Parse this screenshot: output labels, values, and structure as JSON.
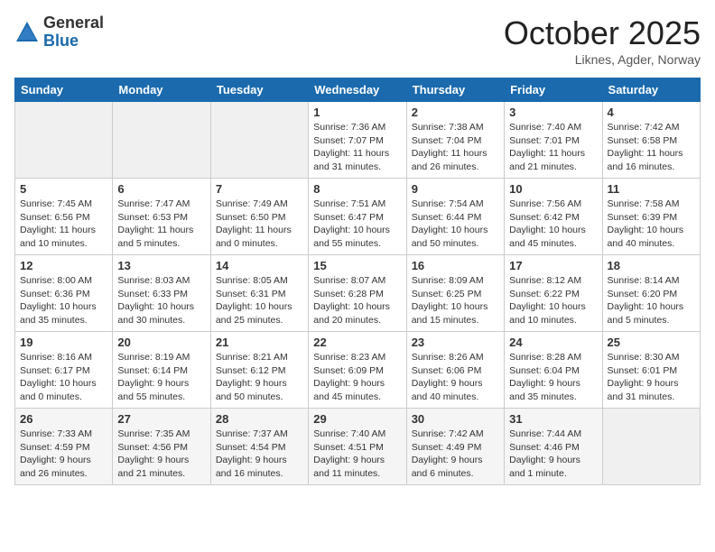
{
  "header": {
    "logo_general": "General",
    "logo_blue": "Blue",
    "month_title": "October 2025",
    "location": "Liknes, Agder, Norway"
  },
  "days_of_week": [
    "Sunday",
    "Monday",
    "Tuesday",
    "Wednesday",
    "Thursday",
    "Friday",
    "Saturday"
  ],
  "weeks": [
    [
      {
        "day": "",
        "info": ""
      },
      {
        "day": "",
        "info": ""
      },
      {
        "day": "",
        "info": ""
      },
      {
        "day": "1",
        "info": "Sunrise: 7:36 AM\nSunset: 7:07 PM\nDaylight: 11 hours\nand 31 minutes."
      },
      {
        "day": "2",
        "info": "Sunrise: 7:38 AM\nSunset: 7:04 PM\nDaylight: 11 hours\nand 26 minutes."
      },
      {
        "day": "3",
        "info": "Sunrise: 7:40 AM\nSunset: 7:01 PM\nDaylight: 11 hours\nand 21 minutes."
      },
      {
        "day": "4",
        "info": "Sunrise: 7:42 AM\nSunset: 6:58 PM\nDaylight: 11 hours\nand 16 minutes."
      }
    ],
    [
      {
        "day": "5",
        "info": "Sunrise: 7:45 AM\nSunset: 6:56 PM\nDaylight: 11 hours\nand 10 minutes."
      },
      {
        "day": "6",
        "info": "Sunrise: 7:47 AM\nSunset: 6:53 PM\nDaylight: 11 hours\nand 5 minutes."
      },
      {
        "day": "7",
        "info": "Sunrise: 7:49 AM\nSunset: 6:50 PM\nDaylight: 11 hours\nand 0 minutes."
      },
      {
        "day": "8",
        "info": "Sunrise: 7:51 AM\nSunset: 6:47 PM\nDaylight: 10 hours\nand 55 minutes."
      },
      {
        "day": "9",
        "info": "Sunrise: 7:54 AM\nSunset: 6:44 PM\nDaylight: 10 hours\nand 50 minutes."
      },
      {
        "day": "10",
        "info": "Sunrise: 7:56 AM\nSunset: 6:42 PM\nDaylight: 10 hours\nand 45 minutes."
      },
      {
        "day": "11",
        "info": "Sunrise: 7:58 AM\nSunset: 6:39 PM\nDaylight: 10 hours\nand 40 minutes."
      }
    ],
    [
      {
        "day": "12",
        "info": "Sunrise: 8:00 AM\nSunset: 6:36 PM\nDaylight: 10 hours\nand 35 minutes."
      },
      {
        "day": "13",
        "info": "Sunrise: 8:03 AM\nSunset: 6:33 PM\nDaylight: 10 hours\nand 30 minutes."
      },
      {
        "day": "14",
        "info": "Sunrise: 8:05 AM\nSunset: 6:31 PM\nDaylight: 10 hours\nand 25 minutes."
      },
      {
        "day": "15",
        "info": "Sunrise: 8:07 AM\nSunset: 6:28 PM\nDaylight: 10 hours\nand 20 minutes."
      },
      {
        "day": "16",
        "info": "Sunrise: 8:09 AM\nSunset: 6:25 PM\nDaylight: 10 hours\nand 15 minutes."
      },
      {
        "day": "17",
        "info": "Sunrise: 8:12 AM\nSunset: 6:22 PM\nDaylight: 10 hours\nand 10 minutes."
      },
      {
        "day": "18",
        "info": "Sunrise: 8:14 AM\nSunset: 6:20 PM\nDaylight: 10 hours\nand 5 minutes."
      }
    ],
    [
      {
        "day": "19",
        "info": "Sunrise: 8:16 AM\nSunset: 6:17 PM\nDaylight: 10 hours\nand 0 minutes."
      },
      {
        "day": "20",
        "info": "Sunrise: 8:19 AM\nSunset: 6:14 PM\nDaylight: 9 hours\nand 55 minutes."
      },
      {
        "day": "21",
        "info": "Sunrise: 8:21 AM\nSunset: 6:12 PM\nDaylight: 9 hours\nand 50 minutes."
      },
      {
        "day": "22",
        "info": "Sunrise: 8:23 AM\nSunset: 6:09 PM\nDaylight: 9 hours\nand 45 minutes."
      },
      {
        "day": "23",
        "info": "Sunrise: 8:26 AM\nSunset: 6:06 PM\nDaylight: 9 hours\nand 40 minutes."
      },
      {
        "day": "24",
        "info": "Sunrise: 8:28 AM\nSunset: 6:04 PM\nDaylight: 9 hours\nand 35 minutes."
      },
      {
        "day": "25",
        "info": "Sunrise: 8:30 AM\nSunset: 6:01 PM\nDaylight: 9 hours\nand 31 minutes."
      }
    ],
    [
      {
        "day": "26",
        "info": "Sunrise: 7:33 AM\nSunset: 4:59 PM\nDaylight: 9 hours\nand 26 minutes."
      },
      {
        "day": "27",
        "info": "Sunrise: 7:35 AM\nSunset: 4:56 PM\nDaylight: 9 hours\nand 21 minutes."
      },
      {
        "day": "28",
        "info": "Sunrise: 7:37 AM\nSunset: 4:54 PM\nDaylight: 9 hours\nand 16 minutes."
      },
      {
        "day": "29",
        "info": "Sunrise: 7:40 AM\nSunset: 4:51 PM\nDaylight: 9 hours\nand 11 minutes."
      },
      {
        "day": "30",
        "info": "Sunrise: 7:42 AM\nSunset: 4:49 PM\nDaylight: 9 hours\nand 6 minutes."
      },
      {
        "day": "31",
        "info": "Sunrise: 7:44 AM\nSunset: 4:46 PM\nDaylight: 9 hours\nand 1 minute."
      },
      {
        "day": "",
        "info": ""
      }
    ]
  ]
}
